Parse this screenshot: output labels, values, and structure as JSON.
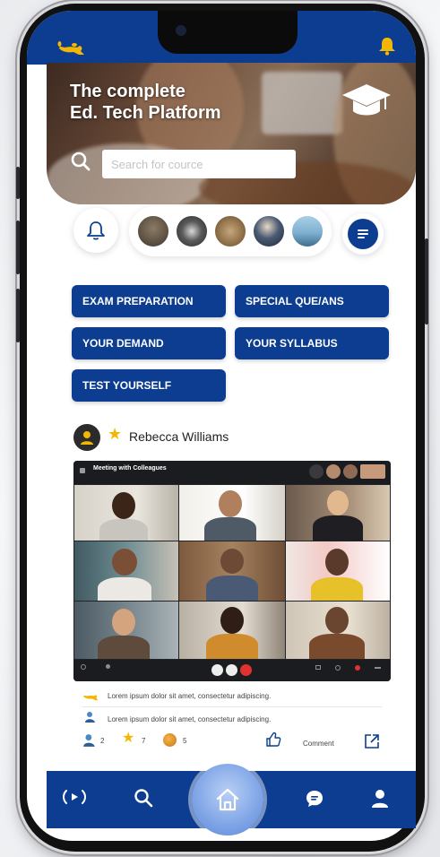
{
  "hero": {
    "title": "The complete\nEd. Tech Platform",
    "search_placeholder": "Search for cource"
  },
  "quick_links": [
    {
      "label": "EXAM PREPARATION"
    },
    {
      "label": "SPECIAL QUE/ANS"
    },
    {
      "label": "YOUR DEMAND"
    },
    {
      "label": "YOUR SYLLABUS"
    },
    {
      "label": "TEST YOURSELF"
    }
  ],
  "post": {
    "author": "Rebecca Williams",
    "meeting_title": "Meeting with Colleagues",
    "lines": [
      "Lorem ipsum dolor sit amet, consectetur adipiscing.",
      "Lorem ipsum dolor sit amet, consectetur adipiscing."
    ],
    "stats": {
      "teachers": "2",
      "stars": "7",
      "coins": "5"
    },
    "comment_label": "Comment"
  },
  "colors": {
    "primary": "#0c3d91",
    "accent": "#f2b705"
  },
  "icons": [
    "lamp-icon",
    "bell-icon",
    "graduation-cap-icon",
    "search-icon",
    "menu-icon",
    "star-icon",
    "thumbs-up-icon",
    "share-icon",
    "broadcast-icon",
    "home-icon",
    "chat-icon",
    "user-icon"
  ]
}
